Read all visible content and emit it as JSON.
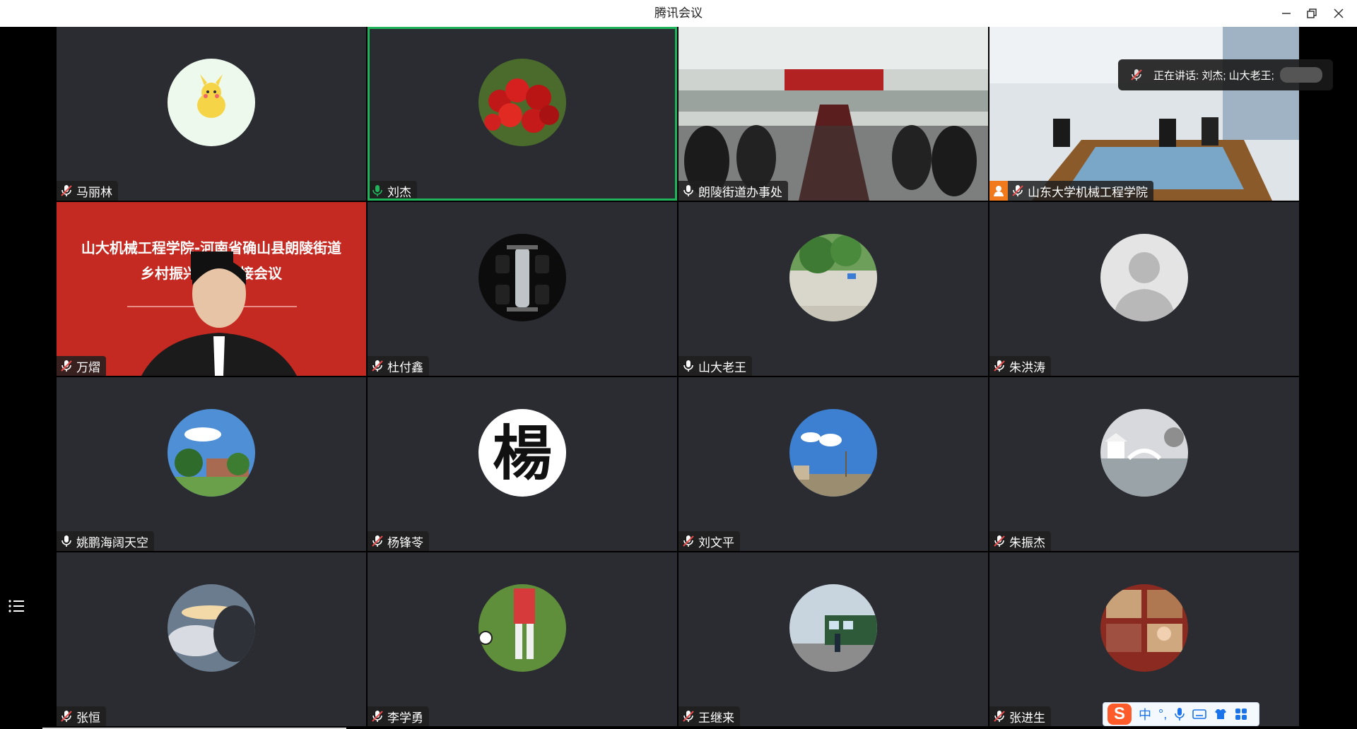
{
  "window": {
    "title": "腾讯会议",
    "minimize_icon": "minimize-icon",
    "restore_icon": "restore-icon",
    "close_icon": "close-icon"
  },
  "speaking_indicator": {
    "label": "正在讲话: 刘杰; 山大老王;",
    "icon": "mic-muted-icon"
  },
  "participants": [
    {
      "name": "马丽林",
      "mic": "muted",
      "tile": "avatar",
      "avatar": "pikachu"
    },
    {
      "name": "刘杰",
      "mic": "speaking",
      "tile": "avatar",
      "avatar": "cherries",
      "active": true
    },
    {
      "name": "朗陵街道办事处",
      "mic": "on",
      "tile": "video",
      "video": "conference-room"
    },
    {
      "name": "山东大学机械工程学院",
      "mic": "muted",
      "tile": "video",
      "video": "meeting-room",
      "host": true
    },
    {
      "name": "万熠",
      "mic": "muted",
      "tile": "video",
      "video": "presenter",
      "slide_line1": "山大机械工程学院-河南省确山县朗陵街道",
      "slide_line2": "乡村振兴工作对接会议"
    },
    {
      "name": "杜付鑫",
      "mic": "muted",
      "tile": "avatar",
      "avatar": "f1-car"
    },
    {
      "name": "山大老王",
      "mic": "on",
      "tile": "avatar",
      "avatar": "stone-wall"
    },
    {
      "name": "朱洪涛",
      "mic": "muted",
      "tile": "avatar",
      "avatar": "default-person"
    },
    {
      "name": "姚鹏海阔天空",
      "mic": "on",
      "tile": "avatar",
      "avatar": "campus-sky"
    },
    {
      "name": "杨锋苓",
      "mic": "muted",
      "tile": "avatar",
      "avatar": "calligraphy",
      "avatar_glyph": "楊"
    },
    {
      "name": "刘文平",
      "mic": "muted",
      "tile": "avatar",
      "avatar": "blue-sky"
    },
    {
      "name": "朱振杰",
      "mic": "muted",
      "tile": "avatar",
      "avatar": "snow-bridge"
    },
    {
      "name": "张恒",
      "mic": "muted",
      "tile": "avatar",
      "avatar": "clouds"
    },
    {
      "name": "李学勇",
      "mic": "muted",
      "tile": "avatar",
      "avatar": "soccer"
    },
    {
      "name": "王继来",
      "mic": "muted",
      "tile": "avatar",
      "avatar": "train"
    },
    {
      "name": "张进生",
      "mic": "muted",
      "tile": "avatar",
      "avatar": "restaurant"
    }
  ],
  "side_menu": {
    "icon": "list-menu-icon"
  },
  "ime_toolbar": {
    "logo": "S",
    "mode": "中",
    "punct": "°,"
  },
  "colors": {
    "active_border": "#1fb35a",
    "tile_bg": "#2a2c31",
    "host_badge": "#f07a1c",
    "speaking_mic": "#1fb35a"
  }
}
